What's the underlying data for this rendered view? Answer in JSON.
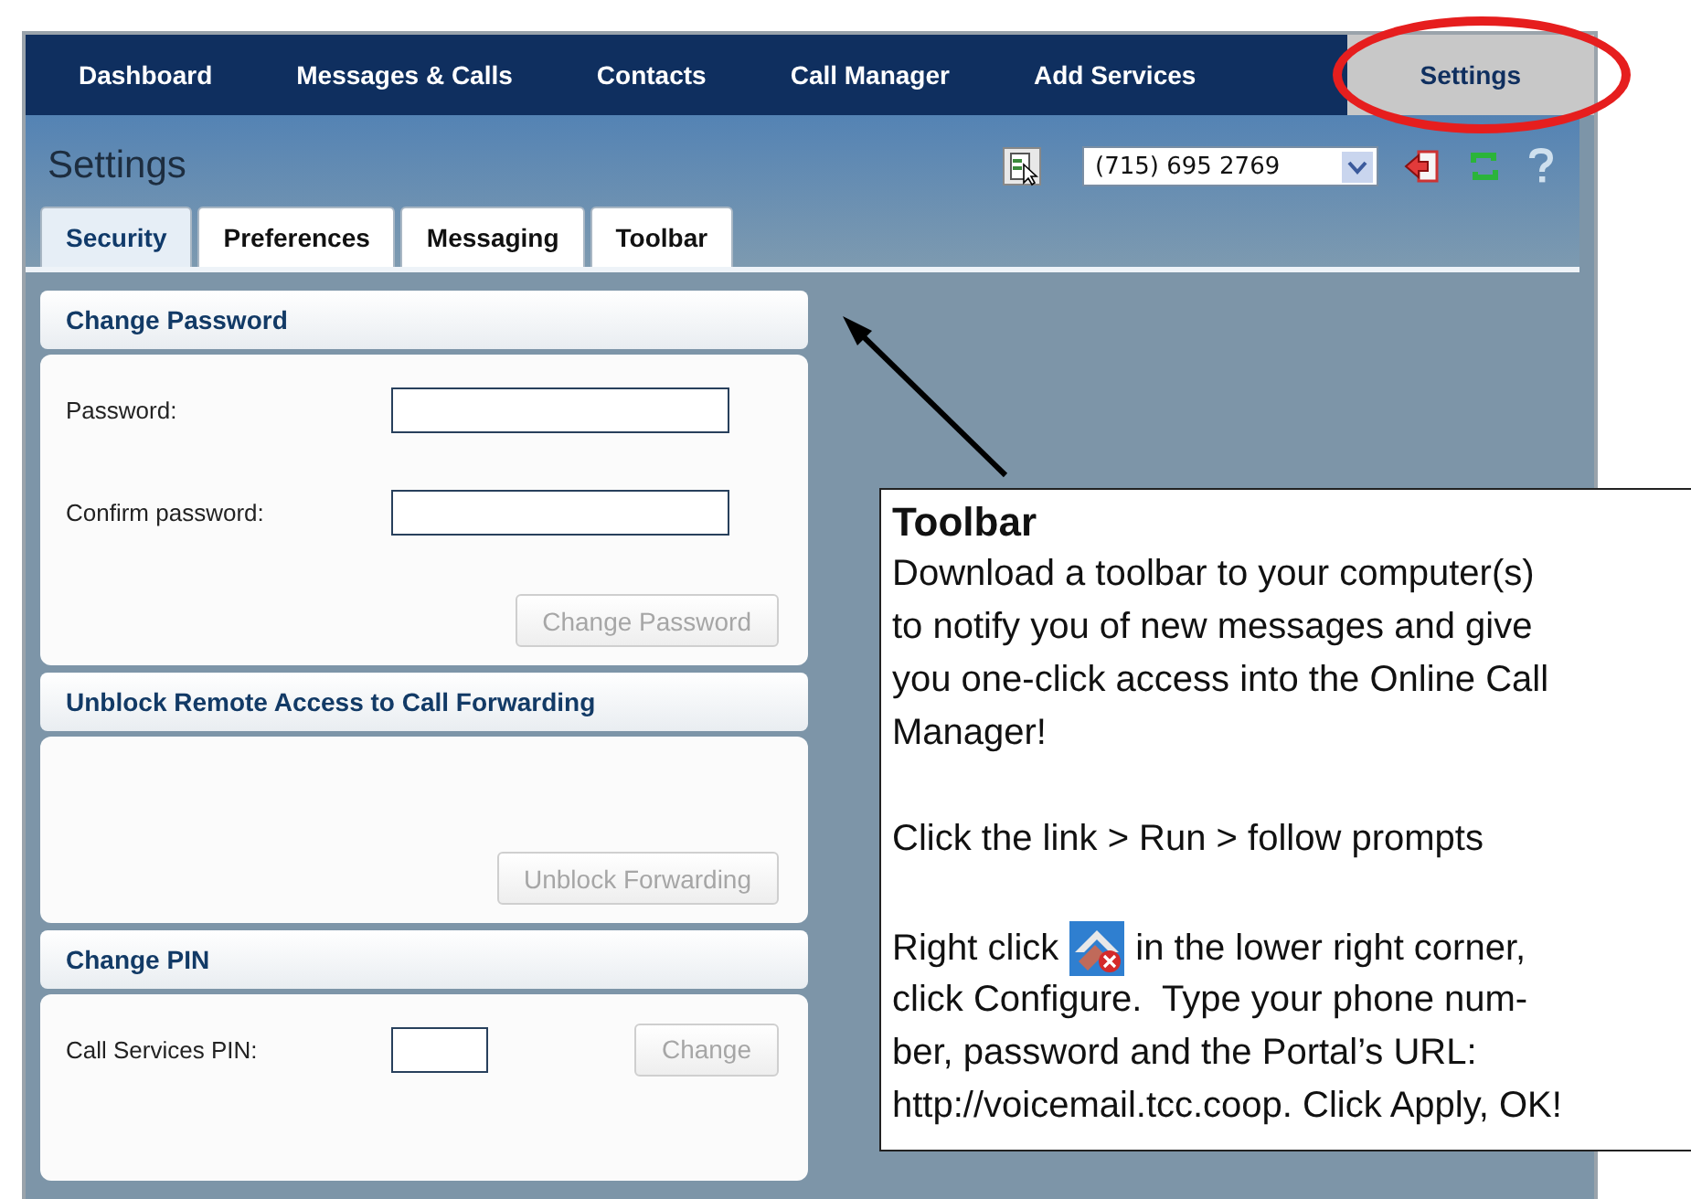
{
  "nav": [
    {
      "label": "Dashboard",
      "selected": false
    },
    {
      "label": "Messages & Calls",
      "selected": false
    },
    {
      "label": "Contacts",
      "selected": false
    },
    {
      "label": "Call Manager",
      "selected": false
    },
    {
      "label": "Add Services",
      "selected": false
    },
    {
      "label": "Settings",
      "selected": true
    }
  ],
  "page_title": "Settings",
  "phone_select": {
    "value": "(715) 695 2769"
  },
  "tabs": [
    {
      "label": "Security",
      "selected": true
    },
    {
      "label": "Preferences",
      "selected": false
    },
    {
      "label": "Messaging",
      "selected": false
    },
    {
      "label": "Toolbar",
      "selected": false
    }
  ],
  "sections": [
    {
      "title": "Change Password",
      "fields": [
        {
          "label": "Password:",
          "kind": "password"
        },
        {
          "label": "Confirm password:",
          "kind": "password"
        }
      ],
      "button": {
        "label": "Change Password",
        "disabled": true
      }
    },
    {
      "title": "Unblock Remote Access to Call Forwarding",
      "button": {
        "label": "Unblock Forwarding",
        "disabled": true
      }
    },
    {
      "title": "Change PIN",
      "fields": [
        {
          "label": "Call Services PIN:",
          "kind": "pin"
        }
      ],
      "button": {
        "label": "Change",
        "disabled": true
      }
    }
  ],
  "callout": {
    "title": "Toolbar",
    "paragraphs": [
      "Download a toolbar to your computer(s)\nto notify you of new messages and give\nyou one-click access into the Online Call\nManager!",
      "Click the link > Run > follow prompts"
    ],
    "icon_line": {
      "before": "Right click",
      "after": "in the lower right corner,"
    },
    "closing": "click Configure.  Type your phone num-\nber, password and the Portal’s URL:\nhttp://voicemail.tcc.coop. Click Apply, OK!"
  }
}
